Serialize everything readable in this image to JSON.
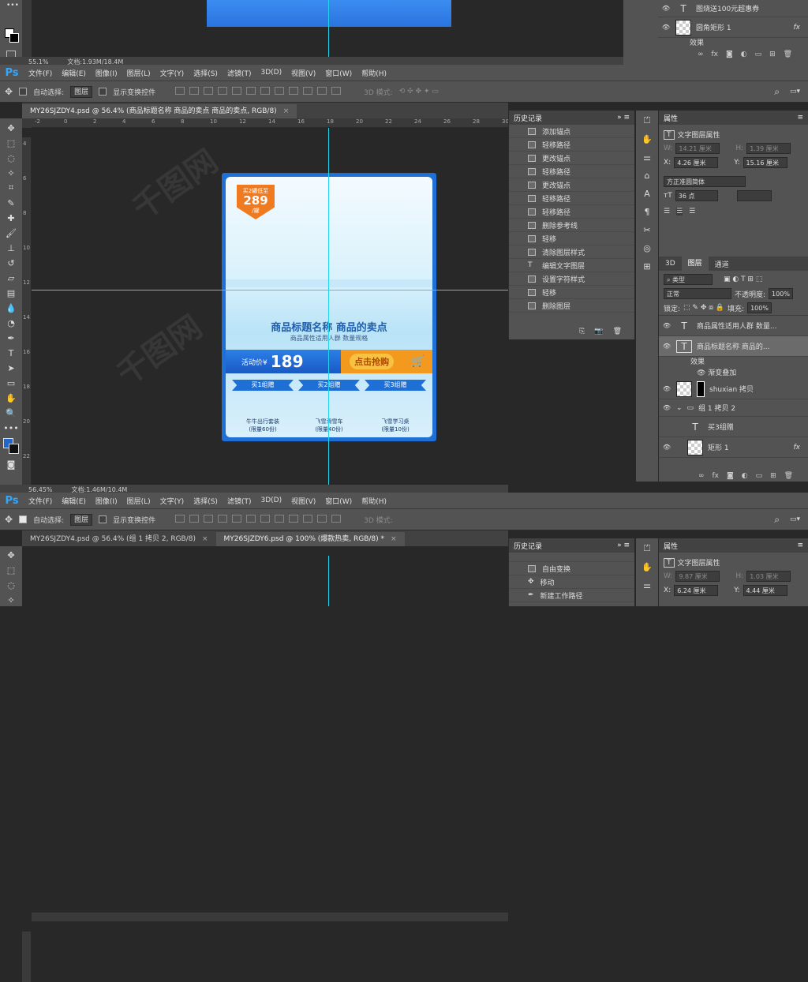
{
  "top_window": {
    "status_zoom": "55.1%",
    "status_doc": "文档:1.93M/18.4M",
    "layers_partial": [
      {
        "name": "图烧送100元超惠券",
        "type": "text"
      },
      {
        "name": "圆角矩形 1",
        "fx": "fx"
      },
      {
        "name": "效果"
      }
    ]
  },
  "menubar": {
    "logo": "Ps",
    "items": [
      "文件(F)",
      "编辑(E)",
      "图像(I)",
      "图层(L)",
      "文字(Y)",
      "选择(S)",
      "滤镜(T)",
      "3D(D)",
      "视图(V)",
      "窗口(W)",
      "帮助(H)"
    ]
  },
  "options": {
    "auto_select_label": "自动选择:",
    "auto_select_value": "图层",
    "show_transform_label": "显示变换控件",
    "mode_3d": "3D 模式:"
  },
  "doc1": {
    "tab": "MY26SJZDY4.psd @ 56.4% (商品标题名称 商品的卖点 商品的卖点, RGB/8)",
    "tab_close": "×",
    "status_zoom": "56.45%",
    "status_doc": "文档:1.46M/10.4M"
  },
  "ruler_h": [
    "-2",
    "0",
    "2",
    "4",
    "6",
    "8",
    "10",
    "12",
    "14",
    "16",
    "18",
    "20",
    "22",
    "24",
    "26",
    "28",
    "30"
  ],
  "ruler_v": [
    "4",
    "6",
    "8",
    "10",
    "12",
    "14",
    "16",
    "18",
    "20",
    "22"
  ],
  "artwork": {
    "tag_line1": "买2罐低至",
    "tag_price": "289",
    "tag_unit": "/罐",
    "title": "商品标题名称 商品的卖点",
    "subtitle": "商品属性适用人群 数量规格",
    "price_label": "活动价¥",
    "price_value": "189",
    "buy_button": "点击抢购",
    "combos": [
      {
        "head": "买1组赠",
        "name": "牛牛出行套装",
        "qty": "(限量60份)"
      },
      {
        "head": "买2组赠",
        "name": "飞雪滑雪车",
        "qty": "(限量40份)"
      },
      {
        "head": "买3组赠",
        "name": "飞雪学习桌",
        "qty": "(限量10份)"
      }
    ]
  },
  "history": {
    "title": "历史记录",
    "items": [
      "添加锚点",
      "轻移路径",
      "更改锚点",
      "轻移路径",
      "更改锚点",
      "轻移路径",
      "轻移路径",
      "删除参考线",
      "轻移",
      "清除图层样式",
      "编辑文字图层",
      "设置字符样式",
      "轻移",
      "删除图层"
    ]
  },
  "properties": {
    "title": "属性",
    "subtitle": "文字图层属性",
    "w_label": "W:",
    "w_value": "14.21 厘米",
    "h_label": "H:",
    "h_value": "1.39 厘米",
    "x_label": "X:",
    "x_value": "4.26 厘米",
    "y_label": "Y:",
    "y_value": "15.16 厘米",
    "font": "方正准圆简体",
    "size": "36 点"
  },
  "layers": {
    "tab_3d": "3D",
    "tab_layers": "图层",
    "tab_channels": "通道",
    "kind": "类型",
    "blend": "正常",
    "opacity_label": "不透明度:",
    "opacity": "100%",
    "lock_label": "锁定:",
    "fill_label": "填充:",
    "fill": "100%",
    "items": [
      {
        "name": "商品属性适用人群 数量...",
        "kind": "text"
      },
      {
        "name": "商品标题名称 商品的...",
        "kind": "text"
      },
      {
        "name": "效果",
        "kind": "effect"
      },
      {
        "name": "渐变叠加",
        "kind": "effect"
      },
      {
        "name": "shuxian 拷贝",
        "kind": "mask"
      },
      {
        "name": "组 1 拷贝 2",
        "kind": "group"
      },
      {
        "name": "买3组赠",
        "kind": "text"
      },
      {
        "name": "矩形 1",
        "kind": "shape",
        "fx": "fx"
      }
    ]
  },
  "bottom_window": {
    "tab1": "MY26SJZDY4.psd @ 56.4% (组 1 拷贝 2, RGB/8)",
    "tab2": "MY26SJZDY6.psd @ 100% (爆款热卖, RGB/8) *",
    "history_items": [
      "自由变换",
      "移动",
      "新建工作路径"
    ],
    "props_subtitle": "文字图层属性",
    "w_value": "9.87 厘米",
    "h_value": "1.03 厘米",
    "x_value": "6.24 厘米",
    "y_value": "4.44 厘米"
  }
}
